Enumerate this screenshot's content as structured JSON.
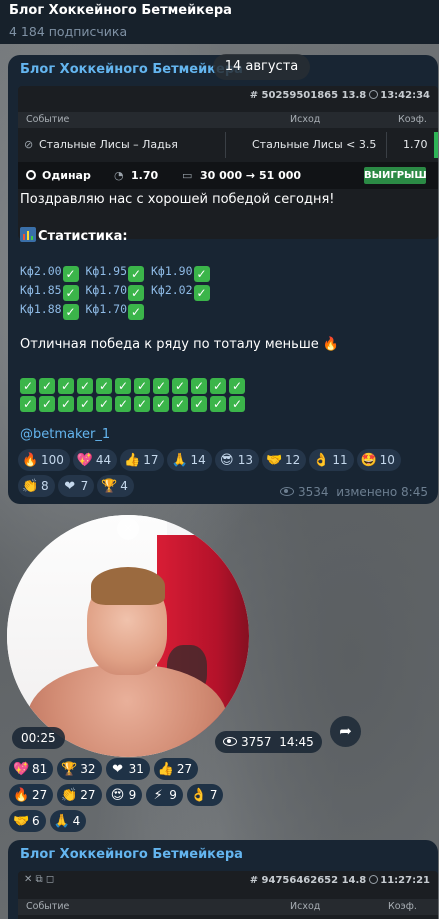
{
  "channel": {
    "title": "Блог Хоккейного Бетмейкера",
    "subscribers": "4 184 подписчика"
  },
  "date_pill": "14 августа",
  "post1": {
    "author": "Блог Хоккейного Бетмейкера",
    "bet_card": {
      "bet_id": "# 50259501865 13.8",
      "bet_time": "13:42:34",
      "headers": {
        "event": "Событие",
        "outcome": "Исход",
        "coef": "Коэф."
      },
      "event": "Стальные Лисы – Ладья",
      "outcome": "Стальные Лисы < 3.5",
      "coef": "1.70",
      "type": "Одинар",
      "total_coef": "1.70",
      "stake": "30 000 → 51 000",
      "status": "ВЫИГРЫШ"
    },
    "text_congrats": "Поздравляю нас с хорошей победой сегодня!",
    "stats_title": "Статистика:",
    "kf_lines": [
      [
        "Кф2.00",
        "Кф1.95",
        "Кф1.90"
      ],
      [
        "Кф1.85",
        "Кф1.70",
        "Кф2.02"
      ],
      [
        "Кф1.88",
        "Кф1.70"
      ]
    ],
    "text_win": "Отличная победа к ряду по тоталу меньше",
    "mention": "@betmaker_1",
    "reactions_row1": [
      {
        "emoji": "🔥",
        "count": "100"
      },
      {
        "emoji": "💖",
        "count": "44"
      },
      {
        "emoji": "👍",
        "count": "17"
      },
      {
        "emoji": "🙏",
        "count": "14"
      },
      {
        "emoji": "😎",
        "count": "13"
      },
      {
        "emoji": "🤝",
        "count": "12"
      },
      {
        "emoji": "👌",
        "count": "11"
      },
      {
        "emoji": "🤩",
        "count": "10"
      }
    ],
    "reactions_row2": [
      {
        "emoji": "👏",
        "count": "8"
      },
      {
        "emoji": "❤",
        "count": "7"
      },
      {
        "emoji": "🏆",
        "count": "4"
      }
    ],
    "views": "3534",
    "edited": "изменено 8:45"
  },
  "video": {
    "duration": "00:25",
    "views": "3757",
    "time": "14:45",
    "reactions_row1": [
      {
        "emoji": "💖",
        "count": "81"
      },
      {
        "emoji": "🏆",
        "count": "32"
      },
      {
        "emoji": "❤",
        "count": "31"
      },
      {
        "emoji": "👍",
        "count": "27"
      }
    ],
    "reactions_row2": [
      {
        "emoji": "🔥",
        "count": "27"
      },
      {
        "emoji": "👏",
        "count": "27"
      },
      {
        "emoji": "😍",
        "count": "9"
      },
      {
        "emoji": "⚡",
        "count": "9"
      },
      {
        "emoji": "👌",
        "count": "7"
      }
    ],
    "reactions_row3": [
      {
        "emoji": "🤝",
        "count": "6"
      },
      {
        "emoji": "🙏",
        "count": "4"
      }
    ]
  },
  "post2": {
    "author": "Блог Хоккейного Бетмейкера",
    "bet_id": "# 94756462652 14.8",
    "bet_time": "11:27:21",
    "headers": {
      "event": "Событие",
      "outcome": "Исход",
      "coef": "Коэф."
    }
  },
  "colors": {
    "header_bg": "#17212b",
    "post_bg": "#182533",
    "accent_link": "#64b5ef",
    "win_green": "#2b8a45",
    "reaction_bg": "#25364a"
  }
}
